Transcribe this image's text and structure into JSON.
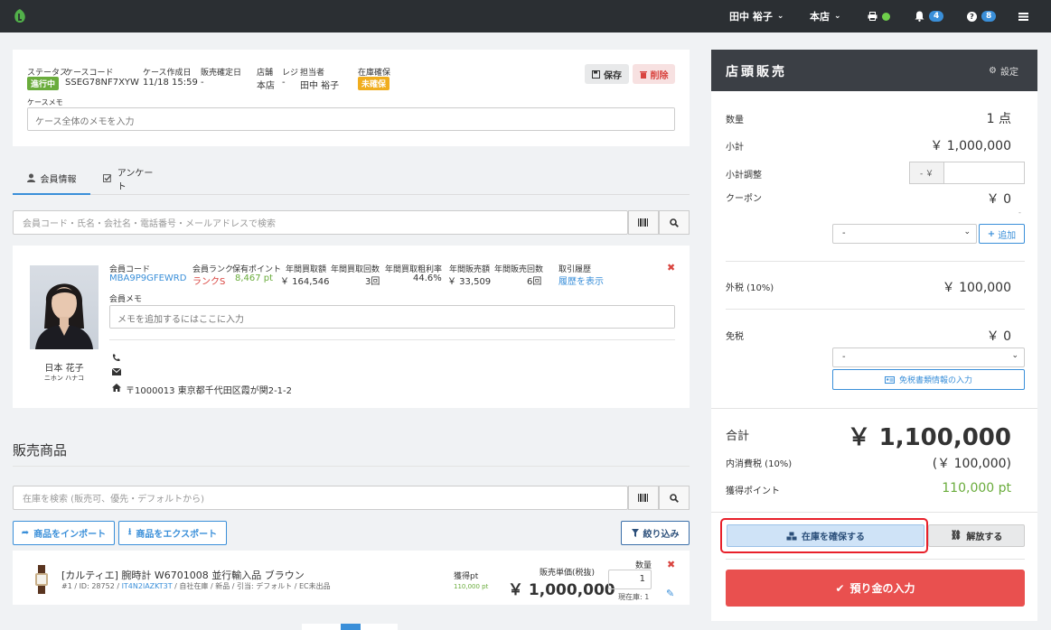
{
  "topbar": {
    "user": "田中 裕子",
    "store": "本店",
    "notifications_count": "4",
    "help_count": "8"
  },
  "case": {
    "status_label": "ステータス",
    "status_value": "進行中",
    "code_label": "ケースコード",
    "code_value": "SSEG78NF7XYW",
    "created_label": "ケース作成日",
    "created_value": "11/18 15:59",
    "sale_date_label": "販売確定日",
    "sale_date_value": "-",
    "store_label": "店舗",
    "store_value": "本店",
    "register_label": "レジ",
    "register_value": "-",
    "staff_label": "担当者",
    "staff_value": "田中 裕子",
    "stock_label": "在庫確保",
    "stock_value": "未確保",
    "save_label": "保存",
    "delete_label": "削除",
    "memo_label": "ケースメモ",
    "memo_placeholder": "ケース全体のメモを入力"
  },
  "tabs": {
    "member_info": "会員情報",
    "survey": "アンケート"
  },
  "member_search": {
    "placeholder": "会員コード・氏名・会社名・電話番号・メールアドレスで検索"
  },
  "member": {
    "name": "日本 花子",
    "kana": "ニホン ハナコ",
    "code_label": "会員コード",
    "code_value": "MBA9P9GFEWRD",
    "rank_label": "会員ランク",
    "rank_value": "ランクS",
    "points_label": "保有ポイント",
    "points_value": "8,467 pt",
    "annual_buy_amount_label": "年間買取額",
    "annual_buy_amount_value": "￥ 164,546",
    "annual_buy_count_label": "年間買取回数",
    "annual_buy_count_value": "3回",
    "annual_buy_margin_label": "年間買取粗利率",
    "annual_buy_margin_value": "44.6%",
    "annual_sales_label": "年間販売額",
    "annual_sales_value": "￥ 33,509",
    "annual_sales_count_label": "年間販売回数",
    "annual_sales_count_value": "6回",
    "history_label": "取引履歴",
    "history_link": "履歴を表示",
    "memo_label": "会員メモ",
    "memo_placeholder": "メモを追加するにはここに入力",
    "address": "〒1000013 東京都千代田区霞が関2-1-2"
  },
  "products": {
    "section_title": "販売商品",
    "search_placeholder": "在庫を検索 (販売可、優先・デフォルトから)",
    "import_label": "商品をインポート",
    "export_label": "商品をエクスポート",
    "filter_label": "絞り込み",
    "items": [
      {
        "name": "[カルティエ] 腕時計 W6701008 並行輸入品 ブラウン",
        "meta_prefix": "#1 / ID: 28752 / ",
        "meta_link": "IT4N2lAZKT3T",
        "meta_suffix": " / 自社在庫 / 新品 / 引当: デフォルト / EC未出品",
        "points_label": "獲得pt",
        "points_value": "110,000 pt",
        "price_label": "販売単価(税抜)",
        "price_value": "￥ 1,000,000",
        "qty_label": "数量",
        "qty_value": "1",
        "stock_text": "現在庫: 1"
      }
    ]
  },
  "panel": {
    "title": "店頭販売",
    "settings_label": "設定",
    "qty_label": "数量",
    "qty_value": "1 点",
    "subtotal_label": "小計",
    "subtotal_value": "￥ 1,000,000",
    "adjust_label": "小計調整",
    "adjust_prefix": "- ￥",
    "coupon_label": "クーポン",
    "coupon_value": "￥ 0",
    "coupon_sub": "-",
    "coupon_select": "-",
    "add_label": "追加",
    "outside_tax_label": "外税 (10%)",
    "outside_tax_value": "￥ 100,000",
    "taxfree_label": "免税",
    "taxfree_value": "￥ 0",
    "taxfree_select": "-",
    "taxfree_doc_label": "免税書類情報の入力",
    "total_label": "合計",
    "total_value": "￥ 1,100,000",
    "inner_tax_label": "内消費税 (10%)",
    "inner_tax_value": "(￥ 100,000)",
    "earned_points_label": "獲得ポイント",
    "earned_points_value": "110,000 pt",
    "reserve_label": "在庫を確保する",
    "release_label": "解放する",
    "deposit_label": "預り金の入力"
  },
  "colors": {
    "topbar": "#2b2f33",
    "accent_blue": "#3a8fd9",
    "status_green": "#6aac3c",
    "warning_yellow": "#f0ad1e",
    "danger_red": "#e9504f",
    "highlight_red": "#e8202a"
  }
}
